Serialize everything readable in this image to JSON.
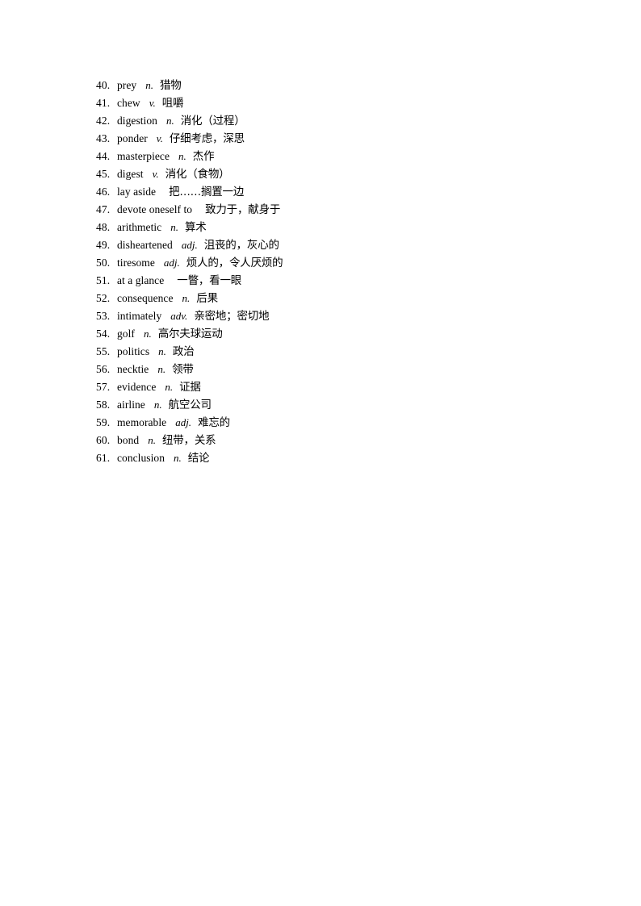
{
  "document": {
    "page_background": "#ffffff",
    "text_color": "#000000",
    "type": "vocabulary-list"
  },
  "vocabulary": {
    "entries": [
      {
        "index": "40.",
        "term": "prey",
        "pos": "n.",
        "gloss": "猎物"
      },
      {
        "index": "41.",
        "term": "chew",
        "pos": "v.",
        "gloss": "咀嚼"
      },
      {
        "index": "42.",
        "term": "digestion",
        "pos": "n.",
        "gloss": "消化（过程）"
      },
      {
        "index": "43.",
        "term": "ponder",
        "pos": "v.",
        "gloss": "仔细考虑，深思"
      },
      {
        "index": "44.",
        "term": "masterpiece",
        "pos": "n.",
        "gloss": "杰作"
      },
      {
        "index": "45.",
        "term": "digest",
        "pos": "v.",
        "gloss": "消化（食物）"
      },
      {
        "index": "46.",
        "term": "lay aside",
        "pos": "",
        "gloss": "把……搁置一边"
      },
      {
        "index": "47.",
        "term": "devote oneself to",
        "pos": "",
        "gloss": "致力于，献身于"
      },
      {
        "index": "48.",
        "term": "arithmetic",
        "pos": "n.",
        "gloss": "算术"
      },
      {
        "index": "49.",
        "term": "disheartened",
        "pos": "adj.",
        "gloss": "沮丧的，灰心的"
      },
      {
        "index": "50.",
        "term": "tiresome",
        "pos": "adj.",
        "gloss": "烦人的，令人厌烦的"
      },
      {
        "index": "51.",
        "term": "at a glance",
        "pos": "",
        "gloss": "一瞥，看一眼"
      },
      {
        "index": "52.",
        "term": "consequence",
        "pos": "n.",
        "gloss": "后果"
      },
      {
        "index": "53.",
        "term": "intimately",
        "pos": "adv.",
        "gloss": "亲密地；密切地"
      },
      {
        "index": "54.",
        "term": "golf",
        "pos": "n.",
        "gloss": "高尔夫球运动"
      },
      {
        "index": "55.",
        "term": "politics",
        "pos": "n.",
        "gloss": "政治"
      },
      {
        "index": "56.",
        "term": "necktie",
        "pos": "n.",
        "gloss": "领带"
      },
      {
        "index": "57.",
        "term": "evidence",
        "pos": "n.",
        "gloss": "证据"
      },
      {
        "index": "58.",
        "term": "airline",
        "pos": "n.",
        "gloss": "航空公司"
      },
      {
        "index": "59.",
        "term": "memorable",
        "pos": "adj.",
        "gloss": "难忘的"
      },
      {
        "index": "60.",
        "term": "bond",
        "pos": "n.",
        "gloss": "纽带，关系"
      },
      {
        "index": "61.",
        "term": "conclusion",
        "pos": "n.",
        "gloss": "结论"
      }
    ]
  }
}
